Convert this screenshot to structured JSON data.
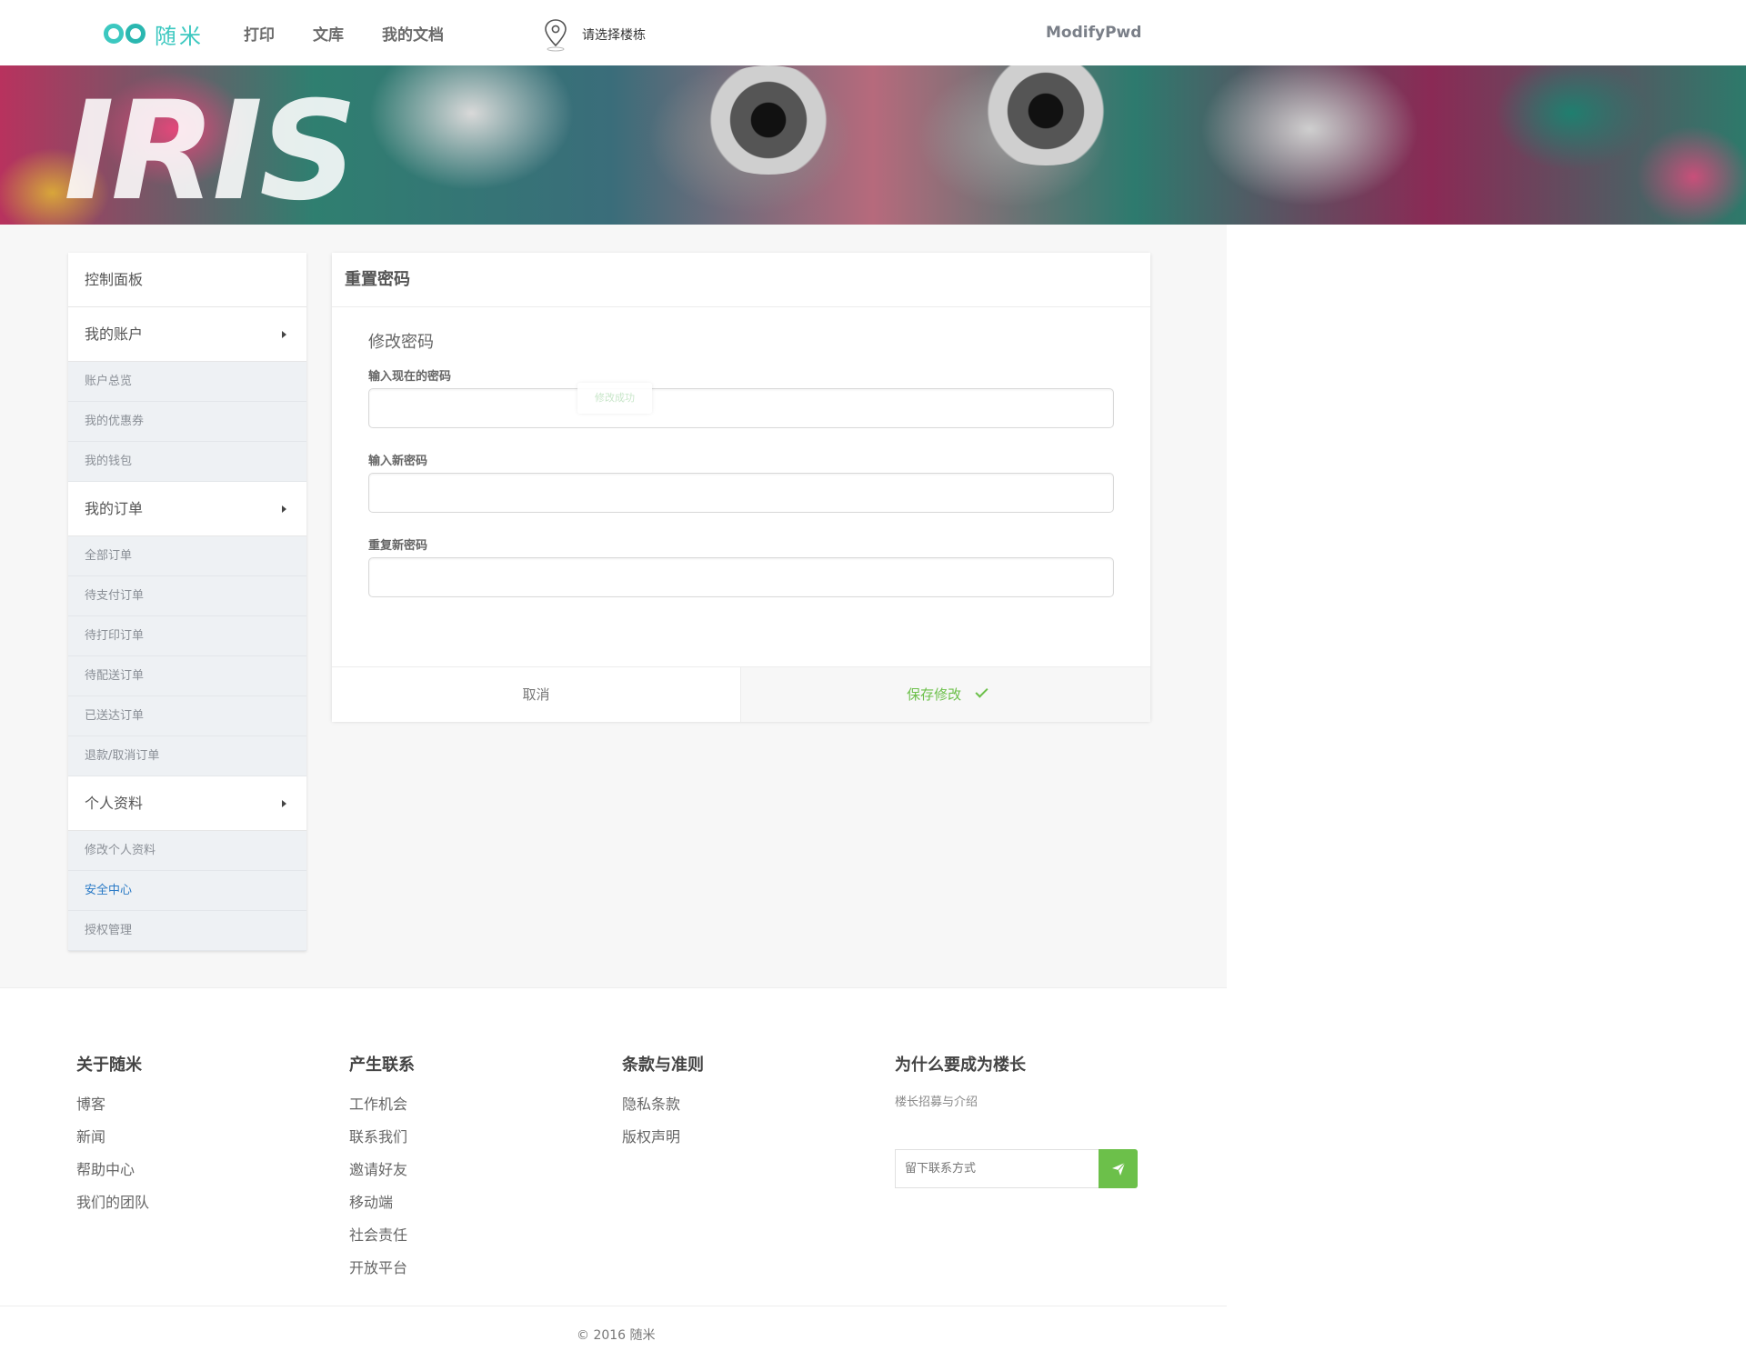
{
  "header": {
    "logo_text": "随米",
    "nav": [
      "打印",
      "文库",
      "我的文档"
    ],
    "location_text": "请选择楼栋",
    "user_name": "ModifyPwd"
  },
  "banner": {
    "title": "IRIS"
  },
  "sidebar": {
    "dashboard": "控制面板",
    "groups": [
      {
        "label": "我的账户",
        "items": [
          "账户总览",
          "我的优惠券",
          "我的钱包"
        ]
      },
      {
        "label": "我的订单",
        "items": [
          "全部订单",
          "待支付订单",
          "待打印订单",
          "待配送订单",
          "已送达订单",
          "退款/取消订单"
        ]
      },
      {
        "label": "个人资料",
        "items": [
          "修改个人资料",
          "安全中心",
          "授权管理"
        ]
      }
    ],
    "active_item": "安全中心"
  },
  "panel": {
    "title": "重置密码",
    "section_title": "修改密码",
    "fields": [
      {
        "label": "输入现在的密码",
        "value": ""
      },
      {
        "label": "输入新密码",
        "value": ""
      },
      {
        "label": "重复新密码",
        "value": ""
      }
    ],
    "toast": "修改成功",
    "cancel_label": "取消",
    "save_label": "保存修改"
  },
  "footer": {
    "columns": [
      {
        "title": "关于随米",
        "links": [
          "博客",
          "新闻",
          "帮助中心",
          "我们的团队"
        ]
      },
      {
        "title": "产生联系",
        "links": [
          "工作机会",
          "联系我们",
          "邀请好友",
          "移动端",
          "社会责任",
          "开放平台"
        ]
      },
      {
        "title": "条款与准则",
        "links": [
          "隐私条款",
          "版权声明"
        ]
      },
      {
        "title": "为什么要成为楼长",
        "links": [
          "楼长招募与介绍"
        ]
      }
    ],
    "subscribe_placeholder": "留下联系方式",
    "copyright": "© 2016 随米"
  },
  "colors": {
    "brand": "#3cc8c0",
    "accent_green": "#6cc04a",
    "active_link": "#2a7ac6"
  },
  "icons": [
    "logo-icon",
    "location-pin-icon",
    "caret-right-icon",
    "check-icon",
    "send-icon"
  ]
}
